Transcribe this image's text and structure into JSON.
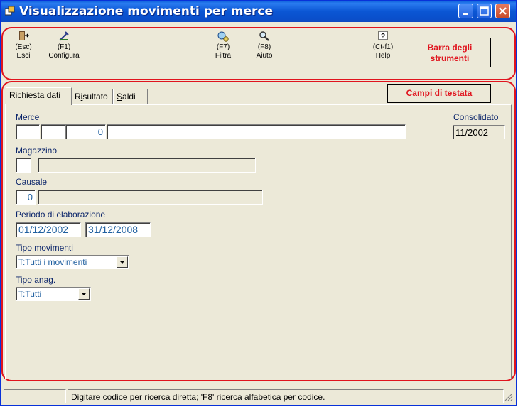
{
  "window": {
    "title": "Visualizzazione movimenti per merce"
  },
  "toolbar": {
    "items": [
      {
        "key": "(Esc)",
        "label": "Esci",
        "icon": "exit-door-icon"
      },
      {
        "key": "(F1)",
        "label": "Configura",
        "icon": "configure-icon"
      },
      {
        "key": "(F7)",
        "label": "Filtra",
        "icon": "filter-icon"
      },
      {
        "key": "(F8)",
        "label": "Aiuto",
        "icon": "magnifier-icon"
      },
      {
        "key": "(Ct-f1)",
        "label": "Help",
        "icon": "help-icon"
      }
    ],
    "callout": "Barra degli strumenti"
  },
  "tabs": [
    {
      "prefix": "",
      "underline": "R",
      "rest": "ichiesta dati",
      "active": true
    },
    {
      "prefix": "R",
      "underline": "i",
      "rest": "sultato",
      "active": false
    },
    {
      "prefix": "",
      "underline": "S",
      "rest": "aldi",
      "active": false
    }
  ],
  "header_callout": "Campi di testata",
  "form": {
    "merce": {
      "label": "Merce",
      "code1": "",
      "code2": "",
      "number": "0",
      "description": ""
    },
    "consolidato": {
      "label": "Consolidato",
      "value": "11/2002"
    },
    "magazzino": {
      "label": "Magazzino",
      "code": "",
      "description": ""
    },
    "causale": {
      "label": "Causale",
      "code": "0",
      "description": ""
    },
    "periodo": {
      "label": "Periodo di elaborazione",
      "from": "01/12/2002",
      "to": "31/12/2008"
    },
    "tipo_movimenti": {
      "label": "Tipo movimenti",
      "selected": "T:Tutti i movimenti"
    },
    "tipo_anag": {
      "label": "Tipo anag.",
      "selected": "T:Tutti"
    }
  },
  "statusbar": {
    "left": "",
    "message": "Digitare codice per ricerca diretta; 'F8' ricerca alfabetica per codice."
  },
  "colors": {
    "annotation": "#E0141E",
    "titlebar": "#0A5FD8",
    "label": "#0A246A",
    "value": "#1F5F9F"
  }
}
